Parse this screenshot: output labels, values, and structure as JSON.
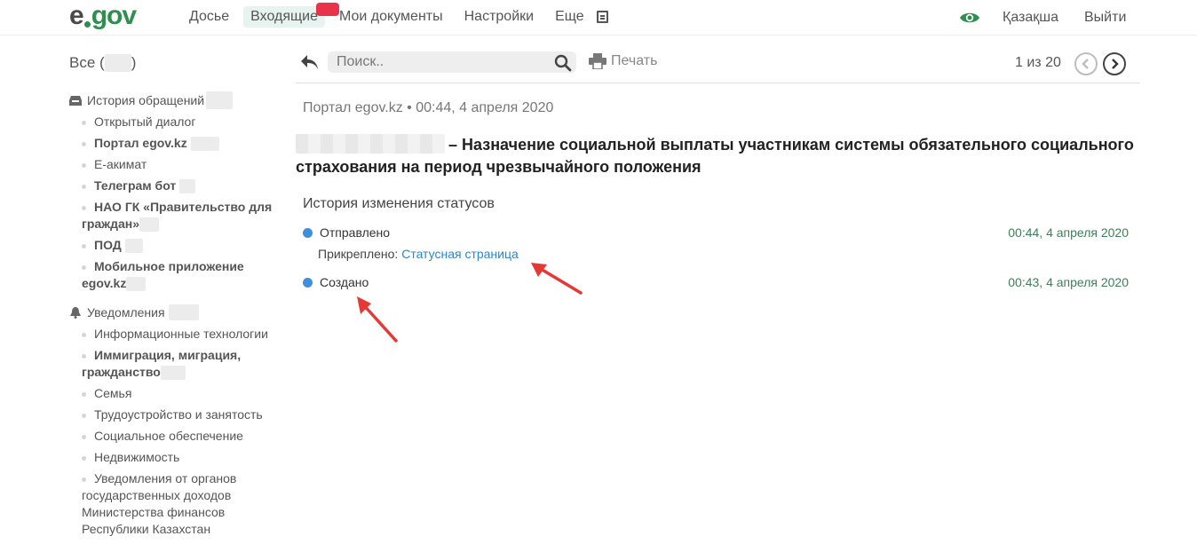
{
  "header": {
    "logo_e": "e",
    "logo_gov": "gov",
    "nav": [
      "Досье",
      "Входящие",
      "Мои документы",
      "Настройки",
      "Еще"
    ],
    "language": "Қазақша",
    "logout": "Выйти"
  },
  "sidebar": {
    "all_label": "Все (",
    "all_close": ")",
    "history": {
      "title": "История обращений",
      "items": [
        {
          "label": "Открытый диалог",
          "bold": false
        },
        {
          "label": "Портал egov.kz",
          "bold": true
        },
        {
          "label": "E-акимат",
          "bold": false
        },
        {
          "label": "Телеграм бот",
          "bold": true
        },
        {
          "label": "НАО ГК «Правительство для",
          "label2": "граждан»",
          "bold": true
        },
        {
          "label": "ПОД",
          "bold": true
        },
        {
          "label": "Мобильное приложение",
          "label2": "egov.kz",
          "bold": true
        }
      ]
    },
    "notifications": {
      "title": "Уведомления",
      "items": [
        {
          "label": "Информационные технологии",
          "bold": false
        },
        {
          "label": "Иммиграция, миграция,",
          "label2": "гражданство",
          "bold": true
        },
        {
          "label": "Семья",
          "bold": false
        },
        {
          "label": "Трудоустройство и занятость",
          "bold": false
        },
        {
          "label": "Социальное обеспечение",
          "bold": false
        },
        {
          "label": "Недвижимость",
          "bold": false
        },
        {
          "label": "Уведомления от органов",
          "label2": "государственных доходов",
          "label3": "Министерства финансов",
          "label4": "Республики Казахстан",
          "bold": false
        }
      ]
    }
  },
  "toolbar": {
    "search_placeholder": "Поиск..",
    "print_label": "Печать",
    "pager": "1 из 20"
  },
  "message": {
    "meta": "Портал egov.kz • 00:44, 4 апреля 2020",
    "subject": "– Назначение социальной выплаты участникам системы обязательного социального страхования на период чрезвычайного положения",
    "history_title": "История изменения статусов",
    "statuses": [
      {
        "label": "Отправлено",
        "time": "00:44, 4 апреля 2020"
      },
      {
        "label": "Создано",
        "time": "00:43, 4 апреля 2020"
      }
    ],
    "attached_label": "Прикреплено:",
    "attached_link": "Статусная страница"
  },
  "colors": {
    "brand": "#2f8f50",
    "badge": "#e8334a",
    "link": "#2d86c7",
    "status_dot": "#3d8fe0",
    "arrow": "#e53935"
  }
}
